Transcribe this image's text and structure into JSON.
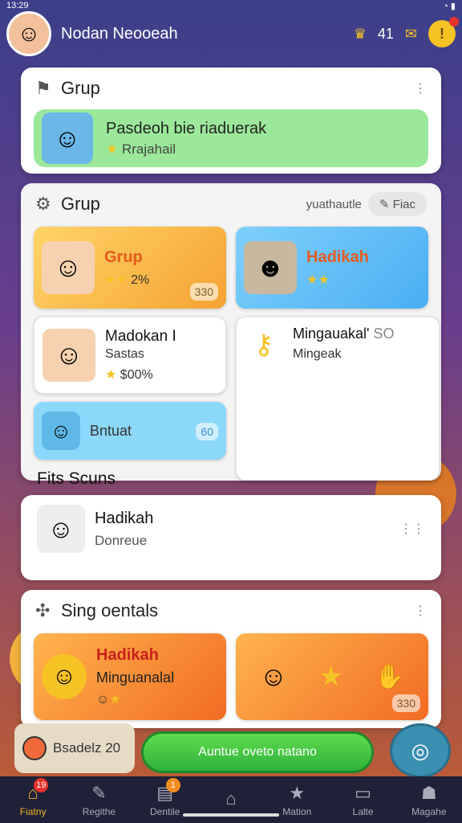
{
  "status": {
    "time": "13:29"
  },
  "header": {
    "username": "Nodan Neooeah",
    "level_value": "41"
  },
  "panel1": {
    "title": "Grup",
    "banner_title": "Pasdeoh bie riaduerak",
    "banner_subtitle": "Rrajahail"
  },
  "panel2": {
    "title": "Grup",
    "sublabel": "yuathautle",
    "toggle_label": "Fiac",
    "cards": [
      {
        "title": "Grup",
        "sub": "2%",
        "badge": "330"
      },
      {
        "title": "Hadikah",
        "sub": "",
        "badge": ""
      },
      {
        "title": "Madokan I",
        "sub2": "Sastas",
        "sub": "$00%"
      },
      {
        "title": "Mingauakal'",
        "extra": "SO",
        "sub": "Mingeak"
      },
      {
        "title": "Bntuat",
        "badge": "60"
      }
    ]
  },
  "section": {
    "title": "Fits Scuns"
  },
  "panel3": {
    "title": "Hadikah",
    "subtitle": "Donreue"
  },
  "panel4": {
    "title": "Sing oentals",
    "card1_title": "Hadikah",
    "card1_sub": "Minguanalal",
    "card2_badge": "330"
  },
  "bottom": {
    "left_label": "Bsadelz 20",
    "cta": "Auntue oveto natano"
  },
  "tabs": [
    {
      "label": "Fiatny",
      "badge": "19",
      "icon": "home-icon"
    },
    {
      "label": "Regithe",
      "icon": "pencil-icon"
    },
    {
      "label": "Dentile",
      "badge": "1",
      "icon": "grid-icon"
    },
    {
      "label": "",
      "icon": "house-icon"
    },
    {
      "label": "Mation",
      "icon": "star-icon"
    },
    {
      "label": "Lalte",
      "icon": "folder-icon"
    },
    {
      "label": "Magahe",
      "icon": "person-icon"
    }
  ]
}
